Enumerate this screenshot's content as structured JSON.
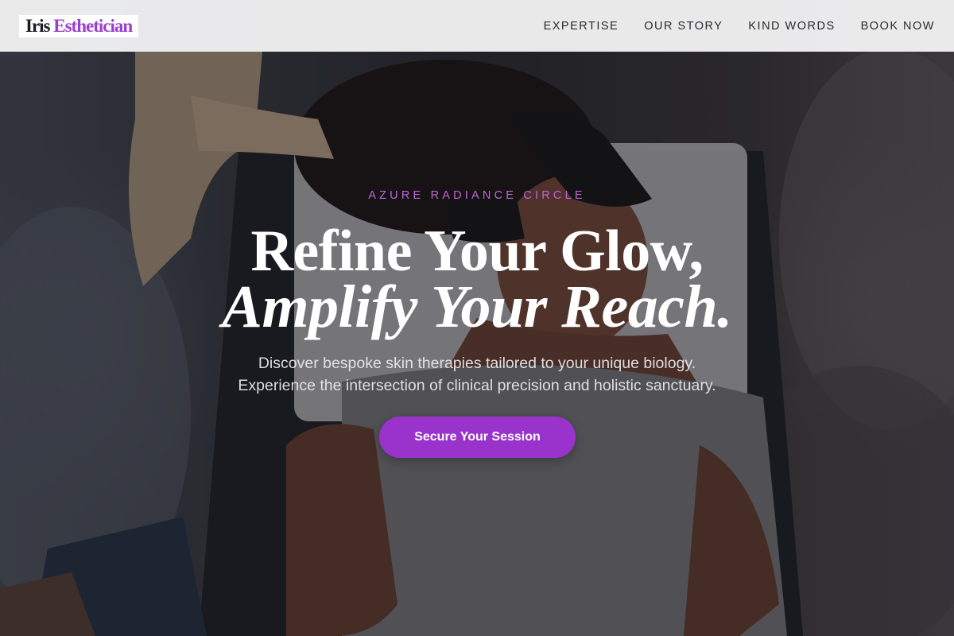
{
  "brand": {
    "name_part1": "Iris",
    "name_part2": "Esthetician",
    "accent_color": "#9b3fd0"
  },
  "nav": {
    "items": [
      {
        "label": "EXPERTISE"
      },
      {
        "label": "OUR STORY"
      },
      {
        "label": "KIND WORDS"
      },
      {
        "label": "BOOK NOW"
      }
    ]
  },
  "hero": {
    "eyebrow": "AZURE RADIANCE CIRCLE",
    "headline_line1": "Refine Your Glow,",
    "headline_line2": "Amplify Your Reach.",
    "description_line1": "Discover bespoke skin therapies tailored to your unique biology.",
    "description_line2": "Experience the intersection of clinical precision and holistic sanctuary.",
    "cta_label": "Secure Your Session",
    "cta_color": "#9a33cc",
    "eyebrow_color": "#c064d8"
  }
}
